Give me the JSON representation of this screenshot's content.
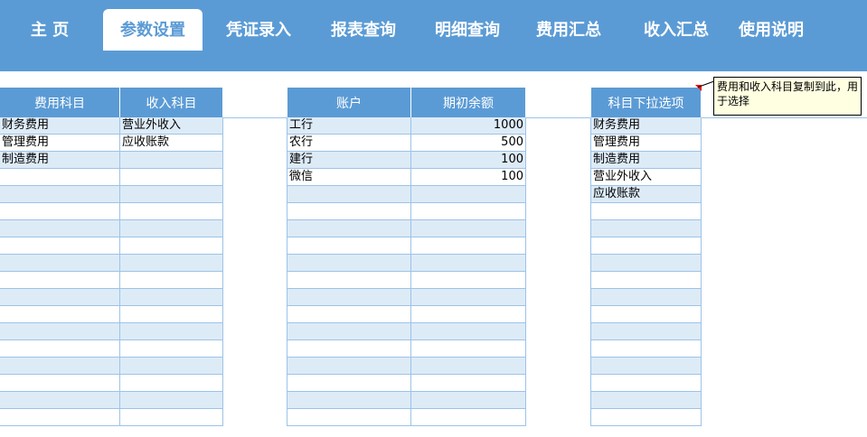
{
  "nav": {
    "tabs": [
      {
        "label": "主  页",
        "active": false
      },
      {
        "label": "参数设置",
        "active": true
      },
      {
        "label": "凭证录入",
        "active": false
      },
      {
        "label": "报表查询",
        "active": false
      },
      {
        "label": "明细查询",
        "active": false
      },
      {
        "label": "费用汇总",
        "active": false
      },
      {
        "label": "收入汇总",
        "active": false
      },
      {
        "label": "使用说明",
        "active": false
      }
    ]
  },
  "subjects_table": {
    "headers": [
      "费用科目",
      "收入科目"
    ],
    "rows": [
      [
        "财务费用",
        "营业外收入"
      ],
      [
        "管理费用",
        "应收账款"
      ],
      [
        "制造费用",
        ""
      ],
      [
        "",
        ""
      ],
      [
        "",
        ""
      ],
      [
        "",
        ""
      ],
      [
        "",
        ""
      ],
      [
        "",
        ""
      ],
      [
        "",
        ""
      ],
      [
        "",
        ""
      ],
      [
        "",
        ""
      ],
      [
        "",
        ""
      ],
      [
        "",
        ""
      ],
      [
        "",
        ""
      ],
      [
        "",
        ""
      ],
      [
        "",
        ""
      ],
      [
        "",
        ""
      ],
      [
        "",
        ""
      ]
    ]
  },
  "accounts_table": {
    "headers": [
      "账户",
      "期初余额"
    ],
    "rows": [
      [
        "工行",
        "1000"
      ],
      [
        "农行",
        "500"
      ],
      [
        "建行",
        "100"
      ],
      [
        "微信",
        "100"
      ],
      [
        "",
        ""
      ],
      [
        "",
        ""
      ],
      [
        "",
        ""
      ],
      [
        "",
        ""
      ],
      [
        "",
        ""
      ],
      [
        "",
        ""
      ],
      [
        "",
        ""
      ],
      [
        "",
        ""
      ],
      [
        "",
        ""
      ],
      [
        "",
        ""
      ],
      [
        "",
        ""
      ],
      [
        "",
        ""
      ],
      [
        "",
        ""
      ],
      [
        "",
        ""
      ]
    ]
  },
  "dropdown_table": {
    "headers": [
      "科目下拉选项"
    ],
    "rows": [
      [
        "财务费用"
      ],
      [
        "管理费用"
      ],
      [
        "制造费用"
      ],
      [
        "营业外收入"
      ],
      [
        "应收账款"
      ],
      [
        ""
      ],
      [
        ""
      ],
      [
        ""
      ],
      [
        ""
      ],
      [
        ""
      ],
      [
        ""
      ],
      [
        ""
      ],
      [
        ""
      ],
      [
        ""
      ],
      [
        ""
      ],
      [
        ""
      ],
      [
        ""
      ],
      [
        ""
      ]
    ]
  },
  "comment": {
    "text": "费用和收入科目复制到此，用于选择"
  },
  "colors": {
    "header_blue": "#5b9bd5",
    "band_light": "#ddebf7",
    "border": "#9dc3e6"
  }
}
